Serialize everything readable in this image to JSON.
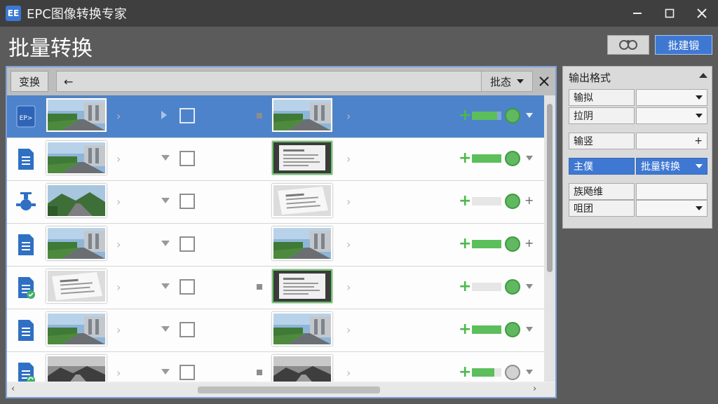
{
  "app": {
    "icon_text": "EE",
    "title": "EPC图像转换专家"
  },
  "header": {
    "page_title": "批量转换",
    "batch_button": "批建锻"
  },
  "toolbar": {
    "convert_label": "变换",
    "back_glyph": "←",
    "dropdown_label": "批态"
  },
  "rows": [
    {
      "file_icon": "epc-file-icon",
      "icon_text": "EP>",
      "thumb1": "road-building",
      "thumb2": "road-building",
      "selected": true,
      "progress": 0.85,
      "status": "complete",
      "action": "expand"
    },
    {
      "file_icon": "document-icon",
      "thumb1": "road-building",
      "thumb2": "document-scan",
      "selected": false,
      "progress": 1.0,
      "status": "complete",
      "action": "expand"
    },
    {
      "file_icon": "valve-icon",
      "thumb1": "mountain-road",
      "thumb2": "document-paper",
      "selected": false,
      "progress": 0.0,
      "status": "complete",
      "action": "add"
    },
    {
      "file_icon": "document-icon",
      "thumb1": "road-building",
      "thumb2": "road-building",
      "selected": false,
      "progress": 1.0,
      "status": "complete",
      "action": "add"
    },
    {
      "file_icon": "document-check-icon",
      "thumb1": "document-paper",
      "thumb2": "document-scan",
      "selected": false,
      "progress": 0.0,
      "status": "complete",
      "action": "expand"
    },
    {
      "file_icon": "document-icon",
      "thumb1": "road-building",
      "thumb2": "road-building",
      "selected": false,
      "progress": 1.0,
      "status": "complete",
      "action": "expand"
    },
    {
      "file_icon": "document-sync-icon",
      "thumb1": "bw-road",
      "thumb2": "bw-road",
      "selected": false,
      "progress": 0.75,
      "status": "pending",
      "action": "expand"
    }
  ],
  "panel": {
    "title": "输出格式",
    "props": [
      {
        "label": "输拟",
        "value": "",
        "control": "dropdown"
      },
      {
        "label": "拉阴",
        "value": "",
        "control": "dropdown"
      },
      {
        "label": "输竖",
        "value": "+",
        "control": "plus"
      },
      {
        "label": "主僕",
        "value": "批量转换",
        "control": "dropdown",
        "highlight": true
      },
      {
        "label": "族飏维",
        "value": "",
        "control": "none"
      },
      {
        "label": "咀团",
        "value": "",
        "control": "dropdown"
      }
    ]
  },
  "colors": {
    "accent": "#3f78d2",
    "selected_row": "#4d83cb",
    "success": "#5cbf5c"
  }
}
